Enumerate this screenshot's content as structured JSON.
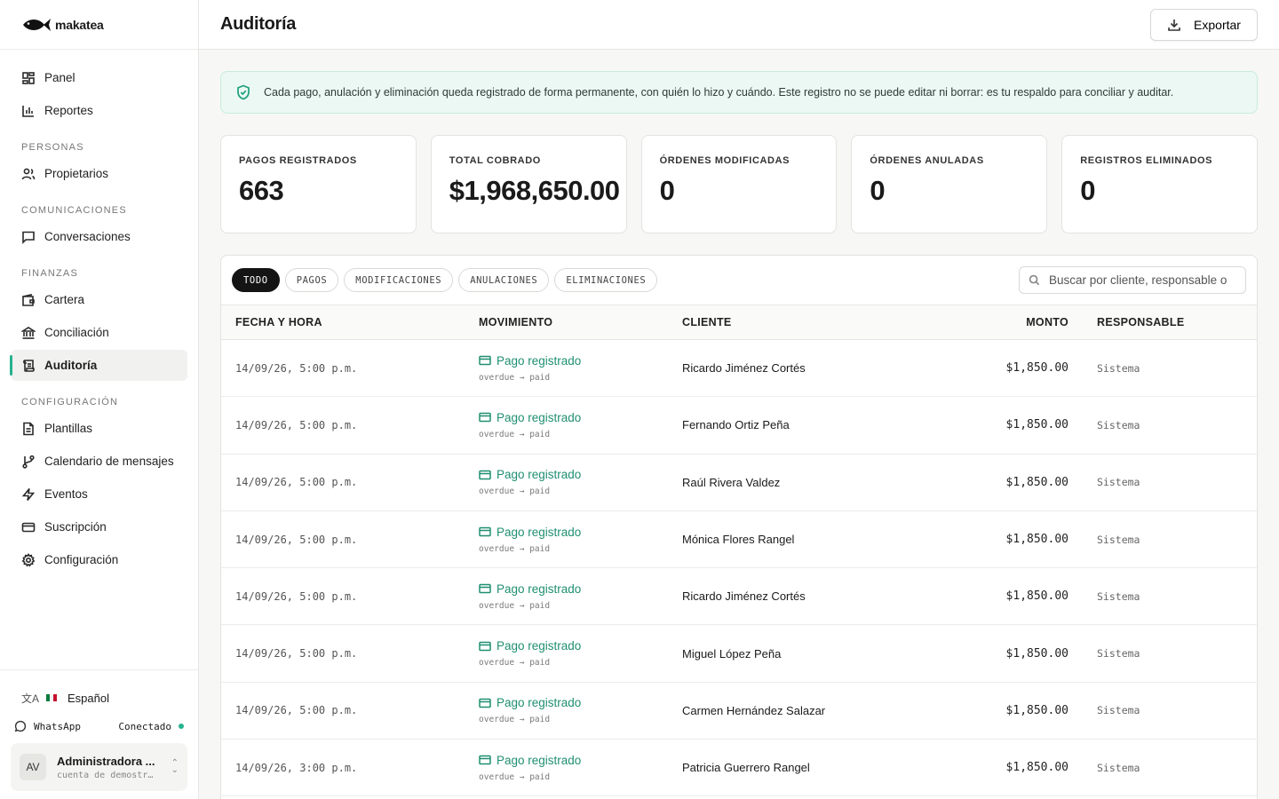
{
  "brand": {
    "name": "makatea"
  },
  "sidebar": {
    "top_items": [
      {
        "label": "Panel",
        "icon": "layout-grid-icon"
      },
      {
        "label": "Reportes",
        "icon": "bar-chart-icon"
      }
    ],
    "sections": [
      {
        "title": "PERSONAS",
        "items": [
          {
            "label": "Propietarios",
            "icon": "users-icon"
          }
        ]
      },
      {
        "title": "COMUNICACIONES",
        "items": [
          {
            "label": "Conversaciones",
            "icon": "message-square-icon"
          }
        ]
      },
      {
        "title": "FINANZAS",
        "items": [
          {
            "label": "Cartera",
            "icon": "wallet-icon"
          },
          {
            "label": "Conciliación",
            "icon": "bank-icon"
          },
          {
            "label": "Auditoría",
            "icon": "scroll-icon",
            "active": true
          }
        ]
      },
      {
        "title": "CONFIGURACIÓN",
        "items": [
          {
            "label": "Plantillas",
            "icon": "file-text-icon"
          },
          {
            "label": "Calendario de mensajes",
            "icon": "git-branch-icon"
          },
          {
            "label": "Eventos",
            "icon": "zap-icon"
          },
          {
            "label": "Suscripción",
            "icon": "credit-card-icon"
          },
          {
            "label": "Configuración",
            "icon": "gear-icon"
          }
        ]
      }
    ],
    "language": "Español",
    "whatsapp": {
      "label": "WhatsApp",
      "status": "Conectado"
    },
    "user": {
      "initials": "AV",
      "name": "Administradora ...",
      "sub": "cuenta de demostr…"
    }
  },
  "header": {
    "title": "Auditoría",
    "export_label": "Exportar"
  },
  "notice": {
    "text": "Cada pago, anulación y eliminación queda registrado de forma permanente, con quién lo hizo y cuándo. Este registro no se puede editar ni borrar: es tu respaldo para conciliar y auditar."
  },
  "stats": [
    {
      "label": "PAGOS REGISTRADOS",
      "value": "663"
    },
    {
      "label": "TOTAL COBRADO",
      "value": "$1,968,650.00"
    },
    {
      "label": "ÓRDENES MODIFICADAS",
      "value": "0"
    },
    {
      "label": "ÓRDENES ANULADAS",
      "value": "0"
    },
    {
      "label": "REGISTROS ELIMINADOS",
      "value": "0"
    }
  ],
  "filters": {
    "chips": [
      "TODO",
      "PAGOS",
      "MODIFICACIONES",
      "ANULACIONES",
      "ELIMINACIONES"
    ],
    "active": 0,
    "search_placeholder": "Buscar por cliente, responsable o"
  },
  "table": {
    "columns": [
      "FECHA Y HORA",
      "MOVIMIENTO",
      "CLIENTE",
      "MONTO",
      "RESPONSABLE"
    ],
    "rows": [
      {
        "date": "14/09/26, 5:00 p.m.",
        "movement": "Pago registrado",
        "detail": "overdue → paid",
        "client": "Ricardo Jiménez Cortés",
        "amount": "$1,850.00",
        "responsible": "Sistema"
      },
      {
        "date": "14/09/26, 5:00 p.m.",
        "movement": "Pago registrado",
        "detail": "overdue → paid",
        "client": "Fernando Ortiz Peña",
        "amount": "$1,850.00",
        "responsible": "Sistema"
      },
      {
        "date": "14/09/26, 5:00 p.m.",
        "movement": "Pago registrado",
        "detail": "overdue → paid",
        "client": "Raúl Rivera Valdez",
        "amount": "$1,850.00",
        "responsible": "Sistema"
      },
      {
        "date": "14/09/26, 5:00 p.m.",
        "movement": "Pago registrado",
        "detail": "overdue → paid",
        "client": "Mónica Flores Rangel",
        "amount": "$1,850.00",
        "responsible": "Sistema"
      },
      {
        "date": "14/09/26, 5:00 p.m.",
        "movement": "Pago registrado",
        "detail": "overdue → paid",
        "client": "Ricardo Jiménez Cortés",
        "amount": "$1,850.00",
        "responsible": "Sistema"
      },
      {
        "date": "14/09/26, 5:00 p.m.",
        "movement": "Pago registrado",
        "detail": "overdue → paid",
        "client": "Miguel López Peña",
        "amount": "$1,850.00",
        "responsible": "Sistema"
      },
      {
        "date": "14/09/26, 5:00 p.m.",
        "movement": "Pago registrado",
        "detail": "overdue → paid",
        "client": "Carmen Hernández Salazar",
        "amount": "$1,850.00",
        "responsible": "Sistema"
      },
      {
        "date": "14/09/26, 3:00 p.m.",
        "movement": "Pago registrado",
        "detail": "overdue → paid",
        "client": "Patricia Guerrero Rangel",
        "amount": "$1,850.00",
        "responsible": "Sistema"
      }
    ]
  },
  "colors": {
    "accent": "#25b38e",
    "movement": "#1f8f70",
    "notice_bg": "#ecf8f3"
  }
}
